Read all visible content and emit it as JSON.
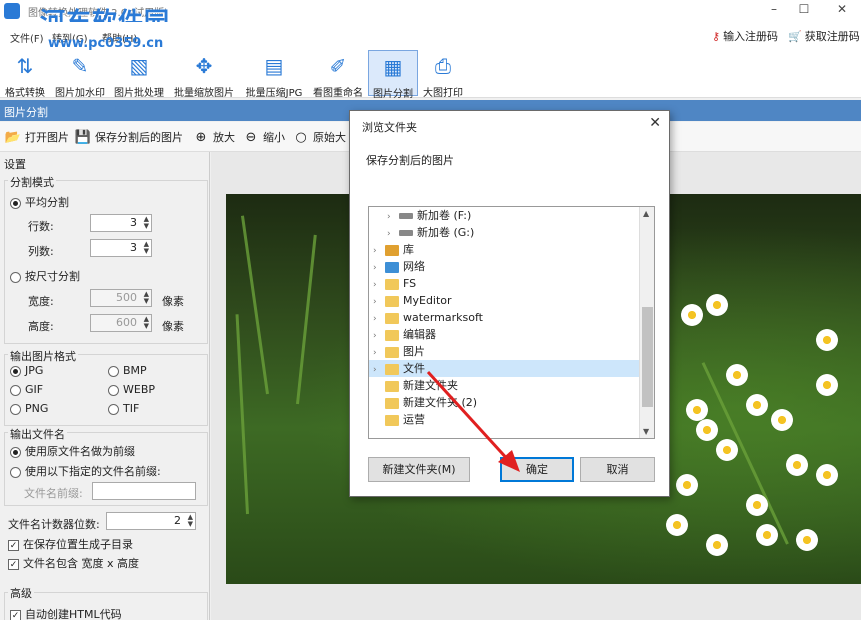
{
  "window": {
    "title": "图像转换处理软件 2.0 (试用版)",
    "watermark": "河东软件园",
    "watermark_url": "www.pc0359.cn",
    "min": "–",
    "max": "☐",
    "close": "✕"
  },
  "menu": {
    "items": [
      "文件(F)",
      "转到(G)",
      "帮助(H)"
    ],
    "register": "输入注册码",
    "get_code": "获取注册码"
  },
  "toolbar": {
    "tools": [
      {
        "label": "格式转换",
        "icon": "convert-icon"
      },
      {
        "label": "图片加水印",
        "icon": "brush-icon"
      },
      {
        "label": "图片批处理",
        "icon": "image-icon"
      },
      {
        "label": "批量缩放图片",
        "icon": "move-icon"
      },
      {
        "label": "批量压缩JPG",
        "icon": "jpg-icon"
      },
      {
        "label": "看图重命名",
        "icon": "rename-icon"
      },
      {
        "label": "图片分割",
        "icon": "grid-icon",
        "active": true
      },
      {
        "label": "大图打印",
        "icon": "printer-icon"
      }
    ]
  },
  "section": {
    "title": "图片分割"
  },
  "subtoolbar": {
    "open": "打开图片",
    "save": "保存分割后的图片",
    "zoom_in": "放大",
    "zoom_out": "缩小",
    "original": "原始大"
  },
  "settings": {
    "title": "设置",
    "split_mode": {
      "title": "分割模式",
      "even": "平均分割",
      "rows_label": "行数:",
      "rows": "3",
      "cols_label": "列数:",
      "cols": "3",
      "by_size": "按尺寸分割",
      "width_label": "宽度:",
      "width": "500",
      "height_label": "高度:",
      "height": "600",
      "unit": "像素"
    },
    "format": {
      "title": "输出图片格式",
      "options": [
        "JPG",
        "BMP",
        "GIF",
        "WEBP",
        "PNG",
        "TIF"
      ],
      "selected": "JPG"
    },
    "filename": {
      "title": "输出文件名",
      "use_original": "使用原文件名做为前缀",
      "use_custom": "使用以下指定的文件名前缀:",
      "prefix_label": "文件名前缀:",
      "prefix": ""
    },
    "counter_label": "文件名计数器位数:",
    "counter": "2",
    "subdir": "在保存位置生成子目录",
    "include_size": "文件名包含 宽度 x 高度",
    "advanced": {
      "title": "高级",
      "html": "自动创建HTML代码"
    }
  },
  "dialog": {
    "title": "浏览文件夹",
    "description": "保存分割后的图片",
    "tree": [
      {
        "label": "新加卷 (F:)",
        "type": "drive",
        "indent": 2
      },
      {
        "label": "新加卷 (G:)",
        "type": "drive",
        "indent": 2
      },
      {
        "label": "库",
        "type": "lib",
        "indent": 1
      },
      {
        "label": "网络",
        "type": "net",
        "indent": 1
      },
      {
        "label": "FS",
        "type": "folder",
        "indent": 1
      },
      {
        "label": "MyEditor",
        "type": "folder",
        "indent": 1
      },
      {
        "label": "watermarksoft",
        "type": "folder",
        "indent": 1
      },
      {
        "label": "编辑器",
        "type": "folder",
        "indent": 1
      },
      {
        "label": "图片",
        "type": "folder",
        "indent": 1
      },
      {
        "label": "文件",
        "type": "folder",
        "indent": 1,
        "selected": true
      },
      {
        "label": "新建文件夹",
        "type": "folder",
        "indent": 1
      },
      {
        "label": "新建文件夹 (2)",
        "type": "folder",
        "indent": 1
      },
      {
        "label": "运营",
        "type": "folder",
        "indent": 1
      }
    ],
    "new_folder": "新建文件夹(M)",
    "ok": "确定",
    "cancel": "取消"
  },
  "colors": {
    "accent": "#2a7ad6",
    "header": "#4f86c4",
    "arrow": "#e02020"
  }
}
